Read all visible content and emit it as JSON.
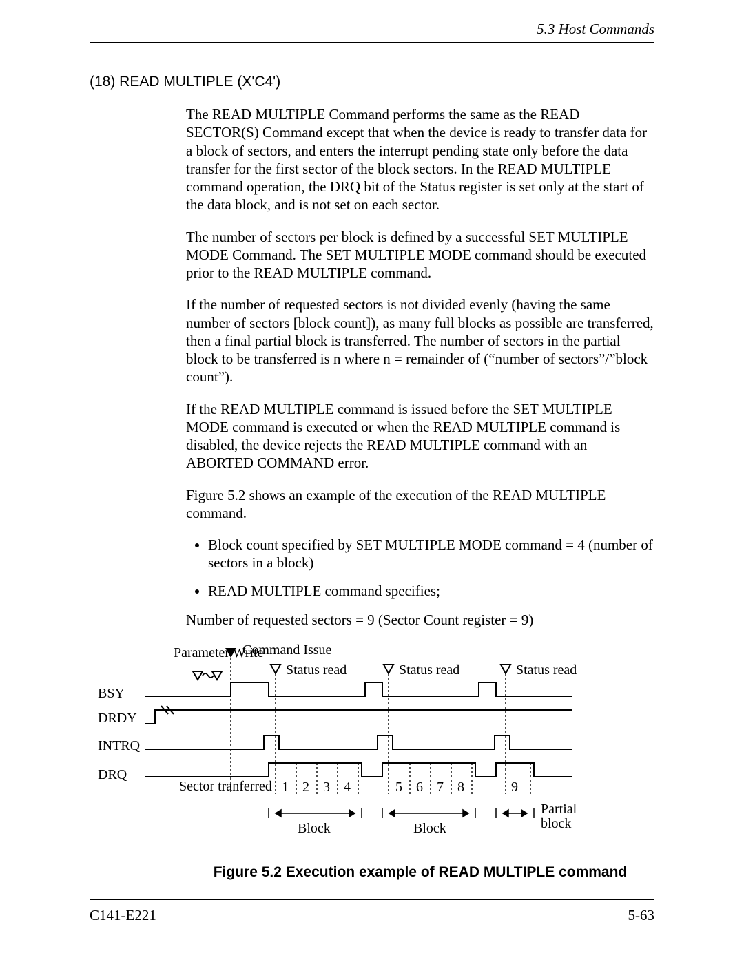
{
  "header": {
    "section": "5.3  Host Commands"
  },
  "heading": "(18)  READ MULTIPLE (X'C4')",
  "paragraphs": {
    "p1": "The READ MULTIPLE Command performs the same as the READ SECTOR(S) Command except that when the device is ready to transfer data for a block of sectors, and enters the interrupt pending state only before the data transfer for the first sector of the block sectors.  In the READ MULTIPLE command operation, the DRQ bit of the Status register is set only at the start of the data block, and is not set on each sector.",
    "p2": "The number of sectors per block is defined by a successful SET MULTIPLE MODE Command.  The SET MULTIPLE MODE command should be executed prior to the READ MULTIPLE command.",
    "p3": "If the number of requested sectors is not divided evenly (having the same number of sectors [block count]), as many full blocks as possible are transferred, then a final partial block is transferred. The number of sectors in the partial block to be transferred is n where n = remainder of (“number of sectors”/”block count”).",
    "p4": "If the READ MULTIPLE command is issued before the SET MULTIPLE MODE command is executed or when the READ MULTIPLE command is disabled, the device rejects the READ MULTIPLE command with an ABORTED COMMAND error.",
    "p5": "Figure 5.2 shows an example of the execution of the READ MULTIPLE command."
  },
  "bullets": {
    "b1": "Block count specified by SET MULTIPLE MODE command = 4 (number of sectors in a block)",
    "b2": "READ MULTIPLE command specifies;"
  },
  "sector_line": "Number of requested sectors = 9 (Sector Count register = 9)",
  "diagram": {
    "parameter_write": "Parameter Write",
    "command_issue": "Command Issue",
    "status_read": "Status read",
    "bsy": "BSY",
    "drdy": "DRDY",
    "intrq": "INTRQ",
    "drq": "DRQ",
    "sector_transferred": "Sector tranferred",
    "block": "Block",
    "partial_block_l1": "Partial",
    "partial_block_l2": "block",
    "nums": {
      "n1": "1",
      "n2": "2",
      "n3": "3",
      "n4": "4",
      "n5": "5",
      "n6": "6",
      "n7": "7",
      "n8": "8",
      "n9": "9"
    }
  },
  "figure_caption": "Figure 5.2  Execution example of READ MULTIPLE command",
  "footer": {
    "doc_id": "C141-E221",
    "page_num": "5-63"
  }
}
